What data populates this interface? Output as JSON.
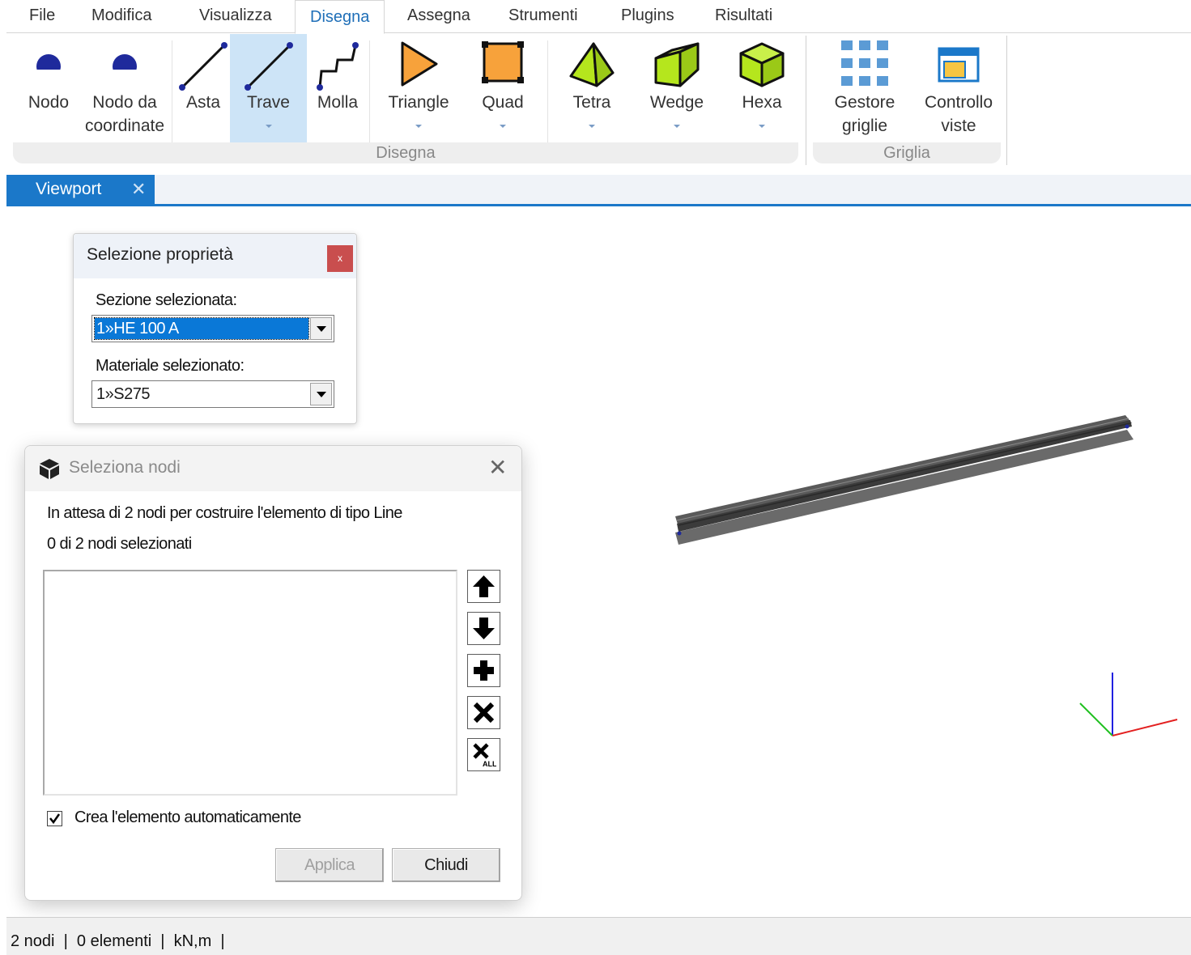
{
  "menu": {
    "items": [
      {
        "label": "File"
      },
      {
        "label": "Modifica"
      },
      {
        "label": "Visualizza"
      },
      {
        "label": "Disegna"
      },
      {
        "label": "Assegna"
      },
      {
        "label": "Strumenti"
      },
      {
        "label": "Plugins"
      },
      {
        "label": "Risultati"
      }
    ],
    "active": "Disegna"
  },
  "ribbon": {
    "buttons": [
      {
        "label": "Nodo",
        "icon": "node-dot-icon"
      },
      {
        "label": "Nodo da coordinate",
        "line1": "Nodo da",
        "line2": "coordinate",
        "icon": "node-dot-icon"
      },
      {
        "label": "Asta",
        "icon": "line-icon"
      },
      {
        "label": "Trave",
        "icon": "line-icon",
        "selected": true
      },
      {
        "label": "Molla",
        "icon": "spring-icon"
      },
      {
        "label": "Triangle",
        "icon": "triangle-icon"
      },
      {
        "label": "Quad",
        "icon": "quad-icon"
      },
      {
        "label": "Tetra",
        "icon": "tetra-icon"
      },
      {
        "label": "Wedge",
        "icon": "wedge-icon"
      },
      {
        "label": "Hexa",
        "icon": "hexa-icon"
      },
      {
        "label": "Gestore griglie",
        "line1": "Gestore",
        "line2": "griglie",
        "icon": "grid-icon"
      },
      {
        "label": "Controllo viste",
        "line1": "Controllo",
        "line2": "viste",
        "icon": "view-window-icon"
      }
    ],
    "groups": [
      {
        "label": "Disegna"
      },
      {
        "label": "Griglia"
      }
    ]
  },
  "tab": {
    "label": "Viewport",
    "close": "✕"
  },
  "properties": {
    "title": "Selezione proprietà",
    "close": "x",
    "section_label": "Sezione selezionata:",
    "section_value": "1»HE 100 A",
    "material_label": "Materiale selezionato:",
    "material_value": "1»S275"
  },
  "node_dialog": {
    "title": "Seleziona nodi",
    "close": "✕",
    "waiting_text": "In attesa di 2 nodi per costruire l'elemento di tipo Line",
    "count_text": "0 di 2 nodi selezionati",
    "side_buttons": [
      "arrow-up-icon",
      "arrow-down-icon",
      "plus-icon",
      "delete-icon",
      "delete-all-icon"
    ],
    "auto_create_label": "Crea l'elemento automaticamente",
    "auto_create_checked": true,
    "apply_label": "Applica",
    "close_label": "Chiudi"
  },
  "status": {
    "text": "2 nodi  |  0 elementi  |  kN,m  |"
  },
  "colors": {
    "accent": "#1b78c9",
    "menu_active": "#1f6fb8",
    "ribbon_selected": "#cde4f7",
    "shape_green": "#b5e61d",
    "shape_orange": "#f7a23b",
    "node_blue": "#1f2a9c",
    "grid_blue": "#5b9bd5",
    "axis_x": "#e32020",
    "axis_y": "#20c020",
    "axis_z": "#2020e0"
  }
}
